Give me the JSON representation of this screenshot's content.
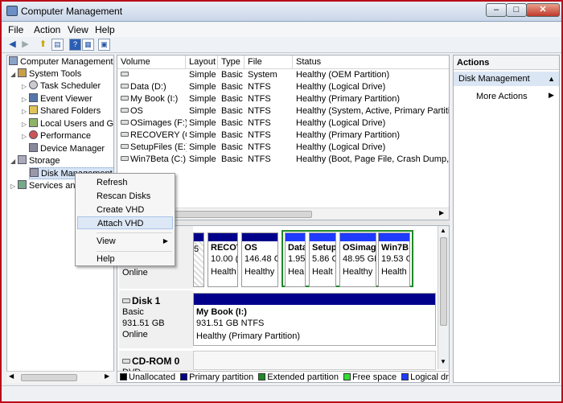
{
  "window": {
    "title": "Computer Management"
  },
  "menubar": [
    "File",
    "Action",
    "View",
    "Help"
  ],
  "tree": {
    "root": "Computer Management",
    "system_tools": "System Tools",
    "task_scheduler": "Task Scheduler",
    "event_viewer": "Event Viewer",
    "shared_folders": "Shared Folders",
    "local_users": "Local Users and Gr",
    "performance": "Performance",
    "device_manager": "Device Manager",
    "storage": "Storage",
    "disk_management": "Disk Management",
    "services": "Services and"
  },
  "columns": [
    "Volume",
    "Layout",
    "Type",
    "File System",
    "Status"
  ],
  "volumes": [
    {
      "volume": "",
      "layout": "Simple",
      "type": "Basic",
      "fs": "",
      "status": "Healthy (OEM Partition)"
    },
    {
      "volume": "Data (D:)",
      "layout": "Simple",
      "type": "Basic",
      "fs": "NTFS",
      "status": "Healthy (Logical Drive)"
    },
    {
      "volume": "My Book (I:)",
      "layout": "Simple",
      "type": "Basic",
      "fs": "NTFS",
      "status": "Healthy (Primary Partition)"
    },
    {
      "volume": "OS",
      "layout": "Simple",
      "type": "Basic",
      "fs": "NTFS",
      "status": "Healthy (System, Active, Primary Partition)"
    },
    {
      "volume": "OSimages (F:)",
      "layout": "Simple",
      "type": "Basic",
      "fs": "NTFS",
      "status": "Healthy (Logical Drive)"
    },
    {
      "volume": "RECOVERY (G:)",
      "layout": "Simple",
      "type": "Basic",
      "fs": "NTFS",
      "status": "Healthy (Primary Partition)"
    },
    {
      "volume": "SetupFiles (E:)",
      "layout": "Simple",
      "type": "Basic",
      "fs": "NTFS",
      "status": "Healthy (Logical Drive)"
    },
    {
      "volume": "Win7Beta (C:)",
      "layout": "Simple",
      "type": "Basic",
      "fs": "NTFS",
      "status": "Healthy (Boot, Page File, Crash Dump, Log"
    }
  ],
  "disk0": {
    "status": "Online",
    "partitions": [
      {
        "name": "",
        "size": "5",
        "health": ""
      },
      {
        "name": "RECOV",
        "size": "10.00 (",
        "health": "Health"
      },
      {
        "name": "OS",
        "size": "146.48 GI",
        "health": "Healthy ("
      },
      {
        "name": "Data",
        "size": "1.95",
        "health": "Hea"
      },
      {
        "name": "Setup",
        "size": "5.86 G",
        "health": "Healt"
      },
      {
        "name": "OSimag",
        "size": "48.95 GI",
        "health": "Healthy"
      },
      {
        "name": "Win7B",
        "size": "19.53 G",
        "health": "Health"
      }
    ]
  },
  "disk1": {
    "label": "Disk 1",
    "kind": "Basic",
    "size": "931.51 GB",
    "status": "Online",
    "part_name": "My Book  (I:)",
    "part_size": "931.51 GB NTFS",
    "part_health": "Healthy (Primary Partition)"
  },
  "cdrom": {
    "label": "CD-ROM 0",
    "kind": "DVD"
  },
  "legend": [
    {
      "label": "Unallocated",
      "color": "#000000"
    },
    {
      "label": "Primary partition",
      "color": "#00008b"
    },
    {
      "label": "Extended partition",
      "color": "#1d8a26"
    },
    {
      "label": "Free space",
      "color": "#33dd33"
    },
    {
      "label": "Logical drive",
      "color": "#1e3bff"
    }
  ],
  "actions": {
    "title": "Actions",
    "section": "Disk Management",
    "more": "More Actions"
  },
  "context_menu": [
    "Refresh",
    "Rescan Disks",
    "Create VHD",
    "Attach VHD",
    "View",
    "Help"
  ]
}
